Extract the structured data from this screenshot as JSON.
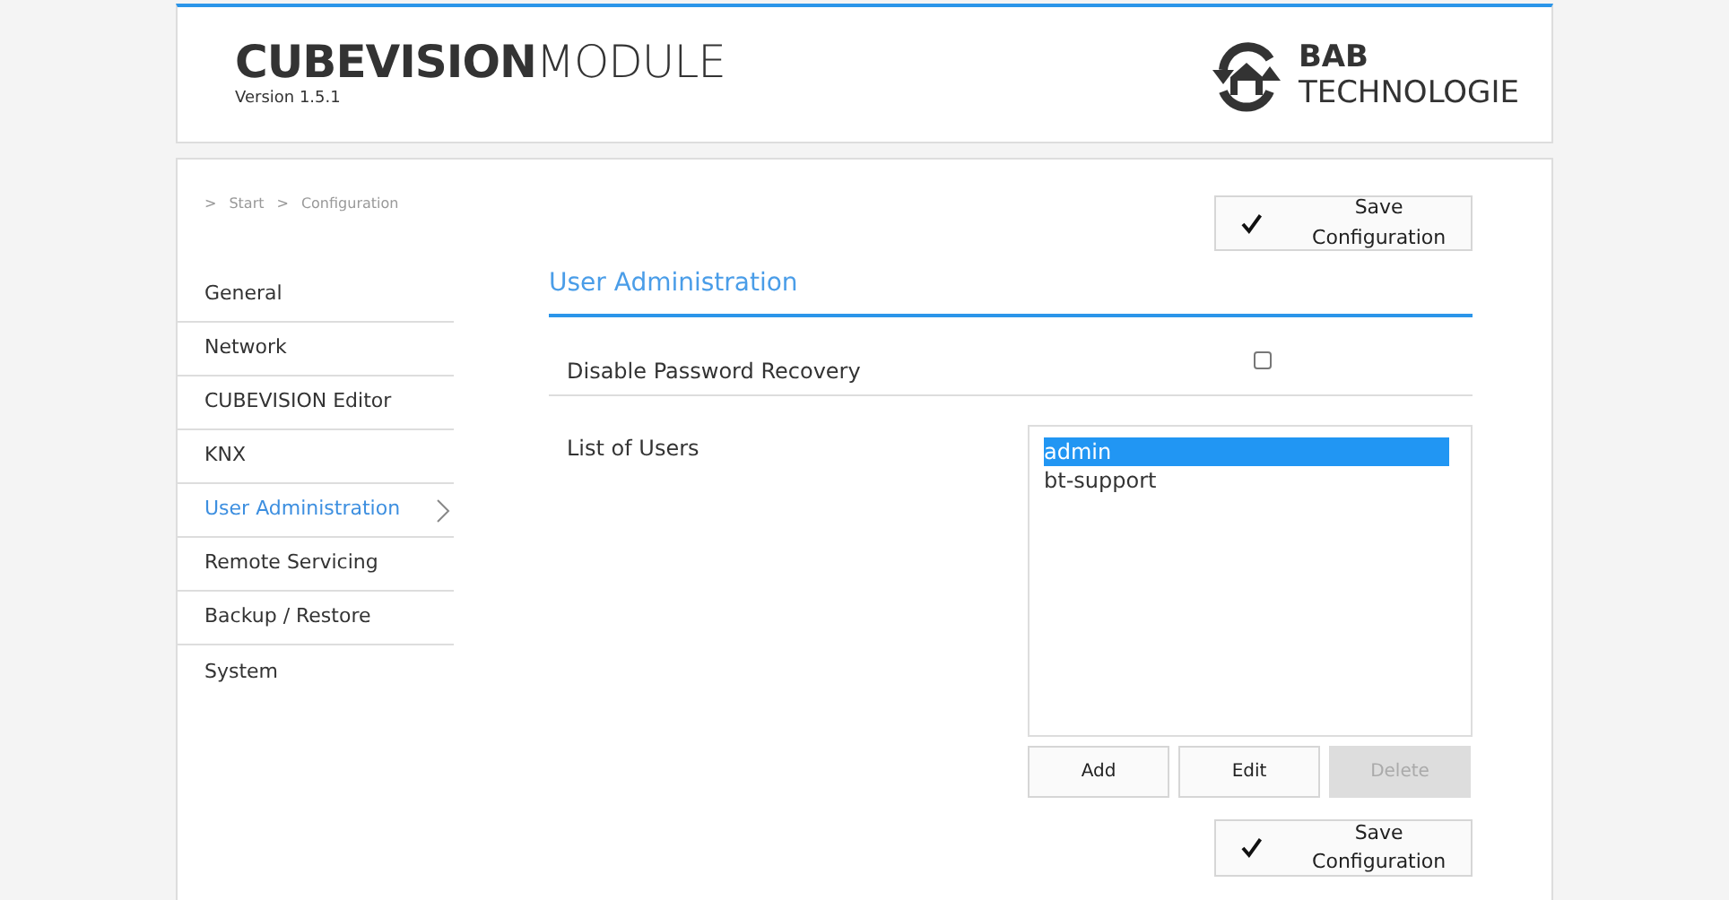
{
  "header": {
    "brand_bold": "CUBEVISION",
    "brand_light": "MODULE",
    "version": "Version 1.5.1",
    "logo_top": "BAB",
    "logo_bottom": "TECHNOLOGIE"
  },
  "breadcrumb": [
    ">",
    "Start",
    ">",
    "Configuration"
  ],
  "sidebar": {
    "items": [
      {
        "label": "General",
        "selected": false
      },
      {
        "label": "Network",
        "selected": false
      },
      {
        "label": "CUBEVISION Editor",
        "selected": false
      },
      {
        "label": "KNX",
        "selected": false
      },
      {
        "label": "User Administration",
        "selected": true
      },
      {
        "label": "Remote Servicing",
        "selected": false
      },
      {
        "label": "Backup / Restore",
        "selected": false
      },
      {
        "label": "System",
        "selected": false
      }
    ]
  },
  "save_button_top": "Save Configuration",
  "section_title": "User Administration",
  "disable_recovery": {
    "label": "Disable Password Recovery",
    "checked": false
  },
  "users": {
    "label": "List of Users",
    "items": [
      {
        "name": "admin",
        "selected": true
      },
      {
        "name": "bt-support",
        "selected": false
      }
    ]
  },
  "user_buttons": [
    {
      "label": "Add",
      "disabled": false
    },
    {
      "label": "Edit",
      "disabled": false
    },
    {
      "label": "Delete",
      "disabled": true
    }
  ],
  "save_button_bottom": "Save Configuration"
}
